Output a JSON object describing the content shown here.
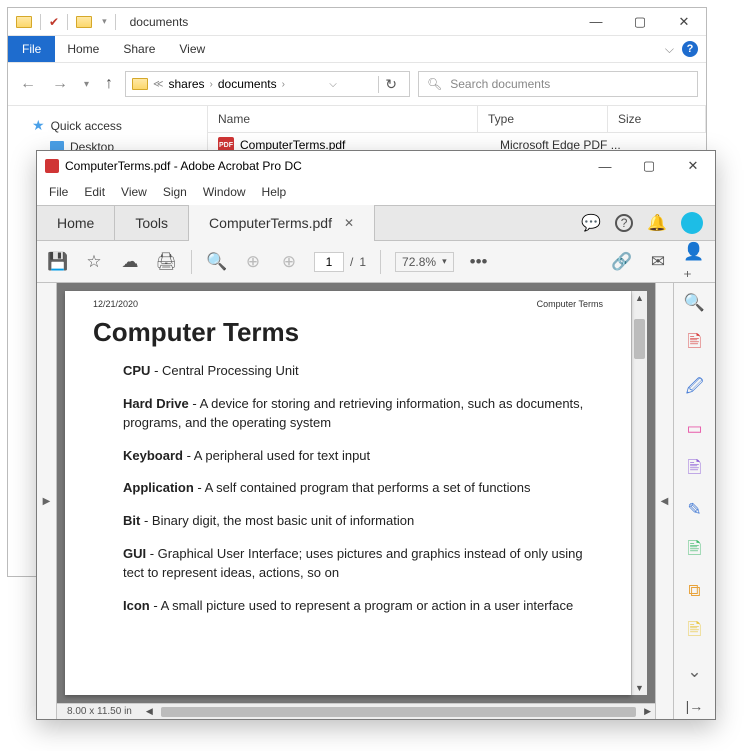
{
  "explorer": {
    "title": "documents",
    "ribbon": {
      "file": "File",
      "home": "Home",
      "share": "Share",
      "view": "View"
    },
    "breadcrumb": {
      "p1": "shares",
      "p2": "documents"
    },
    "search_placeholder": "Search documents",
    "nav": {
      "quick_access": "Quick access",
      "desktop": "Desktop"
    },
    "columns": {
      "name": "Name",
      "type": "Type",
      "size": "Size"
    },
    "file": {
      "name": "ComputerTerms.pdf",
      "type": "Microsoft Edge PDF ...",
      "icon_label": "PDF"
    }
  },
  "acrobat": {
    "title": "ComputerTerms.pdf - Adobe Acrobat Pro DC",
    "menu": {
      "file": "File",
      "edit": "Edit",
      "view": "View",
      "sign": "Sign",
      "window": "Window",
      "help": "Help"
    },
    "tabs": {
      "home": "Home",
      "tools": "Tools",
      "doc": "ComputerTerms.pdf"
    },
    "page_current": "1",
    "page_total": "1",
    "page_sep": "/",
    "zoom": "72.8%",
    "page_dims": "8.00 x 11.50 in",
    "doc": {
      "date": "12/21/2020",
      "header_title": "Computer Terms",
      "h1": "Computer Terms",
      "terms": [
        {
          "t": "CPU",
          "d": " - Central Processing Unit"
        },
        {
          "t": "Hard Drive",
          "d": " - A device for storing and retrieving information, such as documents, programs, and the operating system"
        },
        {
          "t": "Keyboard",
          "d": " - A peripheral used for text input"
        },
        {
          "t": "Application",
          "d": " - A self contained program that performs a set of functions"
        },
        {
          "t": "Bit",
          "d": " - Binary digit, the most basic unit of information"
        },
        {
          "t": "GUI",
          "d": " - Graphical User Interface; uses pictures and graphics instead of only using tect to represent ideas, actions, so on"
        },
        {
          "t": "Icon",
          "d": " - A small picture used to represent a program or action in a user interface"
        }
      ]
    }
  }
}
